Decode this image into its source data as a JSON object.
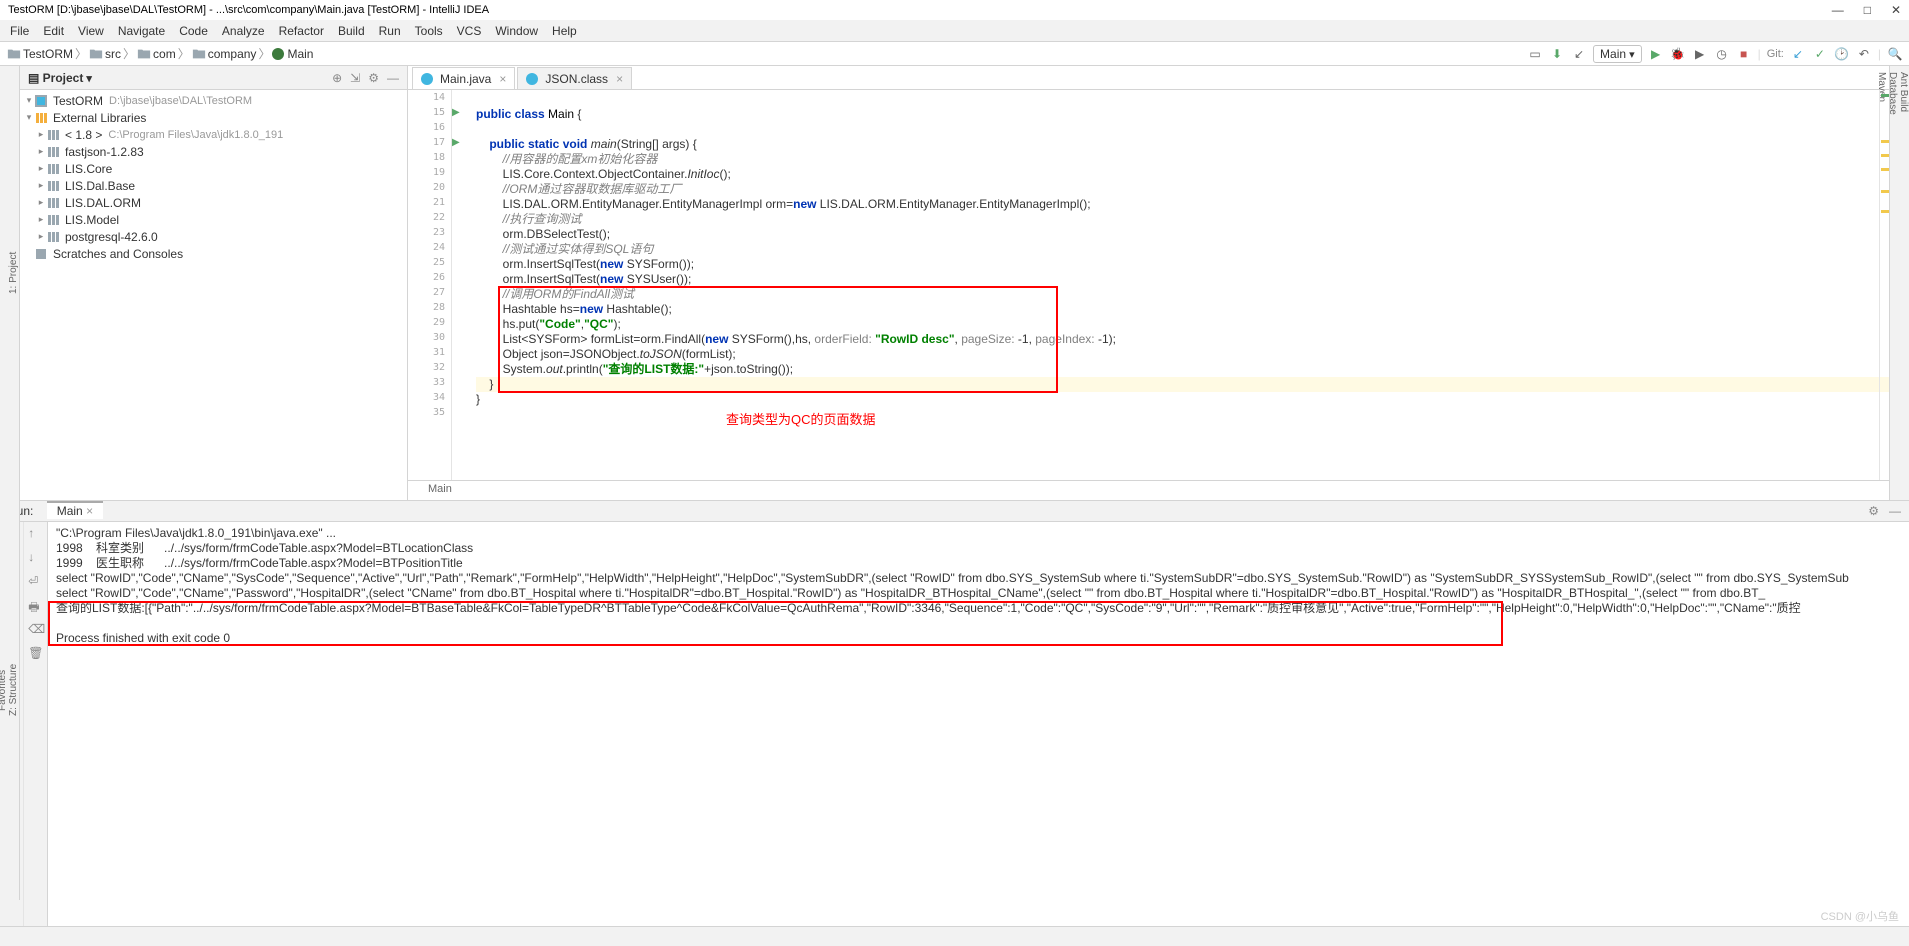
{
  "title": "TestORM [D:\\jbase\\jbase\\DAL\\TestORM] - ...\\src\\com\\company\\Main.java [TestORM] - IntelliJ IDEA",
  "menu": [
    "File",
    "Edit",
    "View",
    "Navigate",
    "Code",
    "Analyze",
    "Refactor",
    "Build",
    "Run",
    "Tools",
    "VCS",
    "Window",
    "Help"
  ],
  "breadcrumb": [
    "TestORM",
    "src",
    "com",
    "company",
    "Main"
  ],
  "run_config": "Main",
  "git_label": "Git:",
  "project_panel_title": "Project",
  "left_tabs": [
    "1: Project"
  ],
  "right_tabs": [
    "Ant Build",
    "Database",
    "Maven"
  ],
  "tree": [
    {
      "label": "TestORM",
      "hint": "D:\\jbase\\jbase\\DAL\\TestORM",
      "depth": 0,
      "icon": "module",
      "caret": "▾"
    },
    {
      "label": "External Libraries",
      "depth": 0,
      "icon": "lib-root",
      "caret": "▾"
    },
    {
      "label": "< 1.8 >",
      "hint": "C:\\Program Files\\Java\\jdk1.8.0_191",
      "depth": 1,
      "icon": "lib",
      "caret": "▸"
    },
    {
      "label": "fastjson-1.2.83",
      "depth": 1,
      "icon": "lib",
      "caret": "▸"
    },
    {
      "label": "LIS.Core",
      "depth": 1,
      "icon": "lib",
      "caret": "▸"
    },
    {
      "label": "LIS.Dal.Base",
      "depth": 1,
      "icon": "lib",
      "caret": "▸"
    },
    {
      "label": "LIS.DAL.ORM",
      "depth": 1,
      "icon": "lib",
      "caret": "▸"
    },
    {
      "label": "LIS.Model",
      "depth": 1,
      "icon": "lib",
      "caret": "▸"
    },
    {
      "label": "postgresql-42.6.0",
      "depth": 1,
      "icon": "lib",
      "caret": "▸"
    },
    {
      "label": "Scratches and Consoles",
      "depth": 0,
      "icon": "scratch",
      "caret": ""
    }
  ],
  "editor_tabs": [
    {
      "label": "Main.java",
      "active": true
    },
    {
      "label": "JSON.class",
      "active": false
    }
  ],
  "code_lines": [
    {
      "n": 14,
      "html": ""
    },
    {
      "n": 15,
      "html": "<span class='kw'>public class</span> <span class='cls'>Main</span> {"
    },
    {
      "n": 16,
      "html": ""
    },
    {
      "n": 17,
      "html": "    <span class='kw'>public static void</span> <span class='fn'>main</span>(String[] args) {"
    },
    {
      "n": 18,
      "html": "        <span class='com'>//用容器的配置xm初始化容器</span>"
    },
    {
      "n": 19,
      "html": "        LIS.Core.Context.ObjectContainer.<span class='fn'>InitIoc</span>();"
    },
    {
      "n": 20,
      "html": "        <span class='com'>//ORM通过容器取数据库驱动工厂</span>"
    },
    {
      "n": 21,
      "html": "        LIS.DAL.ORM.EntityManager.EntityManagerImpl orm=<span class='kw'>new</span> LIS.DAL.ORM.EntityManager.EntityManagerImpl();"
    },
    {
      "n": 22,
      "html": "        <span class='com'>//执行查询测试</span>"
    },
    {
      "n": 23,
      "html": "        orm.DBSelectTest();"
    },
    {
      "n": 24,
      "html": "        <span class='com'>//测试通过实体得到SQL语句</span>"
    },
    {
      "n": 25,
      "html": "        orm.InsertSqlTest(<span class='kw'>new</span> SYSForm());"
    },
    {
      "n": 26,
      "html": "        orm.InsertSqlTest(<span class='kw'>new</span> SYSUser());"
    },
    {
      "n": 27,
      "html": "        <span class='com'>//调用ORM的FindAll测试</span>"
    },
    {
      "n": 28,
      "html": "        Hashtable hs=<span class='kw'>new</span> Hashtable();"
    },
    {
      "n": 29,
      "html": "        hs.put(<span class='str'>\"Code\"</span>,<span class='str'>\"QC\"</span>);"
    },
    {
      "n": 30,
      "html": "        List&lt;SYSForm&gt; formList=orm.FindAll(<span class='kw'>new</span> SYSForm(),hs, <span class='param'>orderField:</span> <span class='str'>\"RowID desc\"</span>, <span class='param'>pageSize:</span> -1, <span class='param'>pageIndex:</span> -1);"
    },
    {
      "n": 31,
      "html": "        Object json=JSONObject.<span class='fn'>toJSON</span>(formList);"
    },
    {
      "n": 32,
      "html": "        System.<span class='fn'>out</span>.println(<span class='str'>\"查询的LIST数据:\"</span>+json.toString());"
    },
    {
      "n": 33,
      "html": "    }"
    },
    {
      "n": 34,
      "html": "}"
    },
    {
      "n": 35,
      "html": ""
    }
  ],
  "editor_breadcrumb": "Main",
  "annotation": "查询类型为QC的页面数据",
  "run_title": "Run:",
  "run_tab": "Main",
  "console_lines": [
    "\"C:\\Program Files\\Java\\jdk1.8.0_191\\bin\\java.exe\" ...",
    "1998    科室类别      ../../sys/form/frmCodeTable.aspx?Model=BTLocationClass",
    "1999    医生职称      ../../sys/form/frmCodeTable.aspx?Model=BTPositionTitle",
    "select \"RowID\",\"Code\",\"CName\",\"SysCode\",\"Sequence\",\"Active\",\"Url\",\"Path\",\"Remark\",\"FormHelp\",\"HelpWidth\",\"HelpHeight\",\"HelpDoc\",\"SystemSubDR\",(select \"RowID\" from dbo.SYS_SystemSub where ti.\"SystemSubDR\"=dbo.SYS_SystemSub.\"RowID\") as \"SystemSubDR_SYSSystemSub_RowID\",(select \"\" from dbo.SYS_SystemSub",
    "select \"RowID\",\"Code\",\"CName\",\"Password\",\"HospitalDR\",(select \"CName\" from dbo.BT_Hospital where ti.\"HospitalDR\"=dbo.BT_Hospital.\"RowID\") as \"HospitalDR_BTHospital_CName\",(select \"\" from dbo.BT_Hospital where ti.\"HospitalDR\"=dbo.BT_Hospital.\"RowID\") as \"HospitalDR_BTHospital_\",(select \"\" from dbo.BT_",
    "查询的LIST数据:[{\"Path\":\"../../sys/form/frmCodeTable.aspx?Model=BTBaseTable&FkCol=TableTypeDR^BTTableType^Code&FkColValue=QcAuthRema\",\"RowID\":3346,\"Sequence\":1,\"Code\":\"QC\",\"SysCode\":\"9\",\"Url\":\"\",\"Remark\":\"质控审核意见\",\"Active\":true,\"FormHelp\":\"\",\"HelpHeight\":0,\"HelpWidth\":0,\"HelpDoc\":\"\",\"CName\":\"质控",
    "",
    "Process finished with exit code 0"
  ],
  "watermark": "CSDN @小乌鱼",
  "bottom_left_tabs": [
    "Z: Structure",
    "Favorites"
  ]
}
